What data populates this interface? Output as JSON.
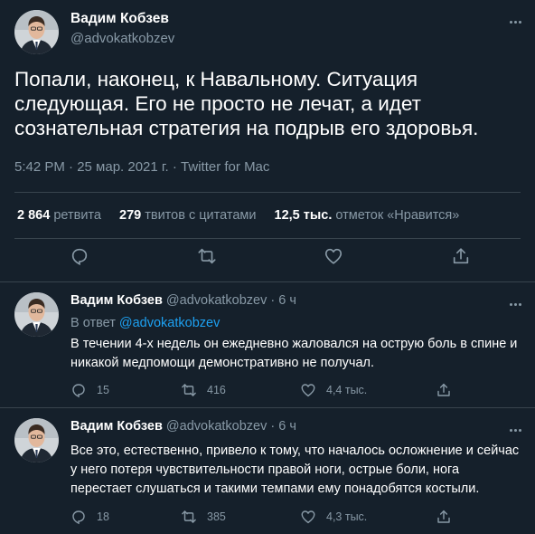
{
  "main_tweet": {
    "author_name": "Вадим Кобзев",
    "author_handle": "@advokatkobzev",
    "text": "Попали, наконец, к Навальному. Ситуация следующая. Его не просто не лечат, а идет сознательная стратегия на подрыв его здоровья.",
    "meta": "5:42 PM · 25 мар. 2021 г. · Twitter for Mac",
    "stats": {
      "retweets_value": "2 864",
      "retweets_label": "ретвита",
      "quotes_value": "279",
      "quotes_label": "твитов с цитатами",
      "likes_value": "12,5 тыс.",
      "likes_label": "отметок «Нравится»"
    },
    "action_icons": [
      "reply-icon",
      "retweet-icon",
      "like-icon",
      "share-icon"
    ]
  },
  "replies": [
    {
      "author_name": "Вадим Кобзев",
      "author_handle": "@advokatkobzev",
      "time": "· 6 ч",
      "in_reply_prefix": "В ответ",
      "in_reply_handle": "@advokatkobzev",
      "text": "В течении 4-х недель он ежедневно жаловался на острую боль в спине и никакой медпомощи демонстративно не получал.",
      "reply_count": "15",
      "retweet_count": "416",
      "like_count": "4,4 тыс."
    },
    {
      "author_name": "Вадим Кобзев",
      "author_handle": "@advokatkobzev",
      "time": "· 6 ч",
      "text": "Все это, естественно, привело к тому, что началось осложнение и сейчас у него потеря чувствительности правой ноги, острые боли, нога перестает слушаться и такими темпами ему понадобятся костыли.",
      "reply_count": "18",
      "retweet_count": "385",
      "like_count": "4,3 тыс."
    }
  ],
  "colors": {
    "background": "#15202b",
    "secondary_text": "#8899a6",
    "link": "#1da1f2",
    "divider": "#38444d"
  }
}
